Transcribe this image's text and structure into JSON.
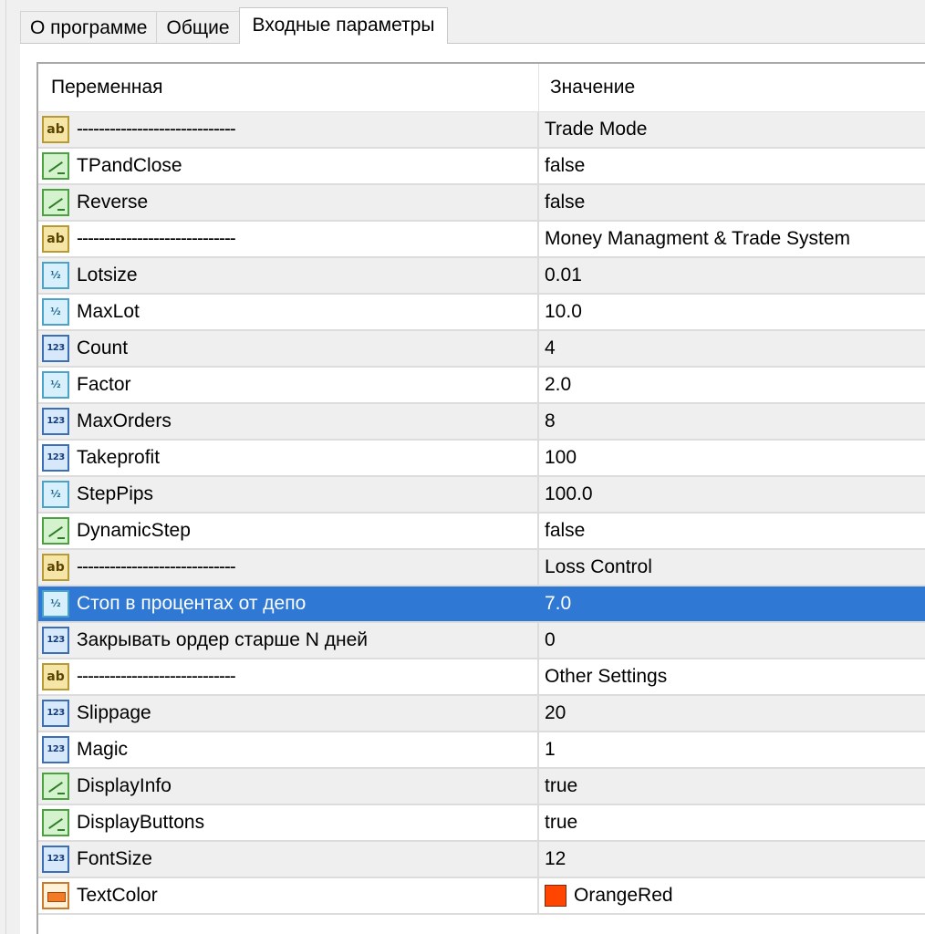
{
  "tabs": [
    {
      "label": "О программе",
      "active": false
    },
    {
      "label": "Общие",
      "active": false
    },
    {
      "label": "Входные параметры",
      "active": true
    }
  ],
  "grid": {
    "columns": {
      "variable": "Переменная",
      "value": "Значение"
    },
    "rows": [
      {
        "type": "str",
        "icon": "string-ab-icon",
        "name": "-----------------------------",
        "value": "Trade Mode"
      },
      {
        "type": "bool",
        "icon": "bool-icon",
        "name": "TPandClose",
        "value": "false"
      },
      {
        "type": "bool",
        "icon": "bool-icon",
        "name": "Reverse",
        "value": "false"
      },
      {
        "type": "str",
        "icon": "string-ab-icon",
        "name": "-----------------------------",
        "value": "Money Managment & Trade System"
      },
      {
        "type": "dbl",
        "icon": "double-icon",
        "name": "Lotsize",
        "value": "0.01"
      },
      {
        "type": "dbl",
        "icon": "double-icon",
        "name": "MaxLot",
        "value": "10.0"
      },
      {
        "type": "int",
        "icon": "integer-123-icon",
        "name": "Count",
        "value": "4"
      },
      {
        "type": "dbl",
        "icon": "double-icon",
        "name": "Factor",
        "value": "2.0"
      },
      {
        "type": "int",
        "icon": "integer-123-icon",
        "name": "MaxOrders",
        "value": "8"
      },
      {
        "type": "int",
        "icon": "integer-123-icon",
        "name": "Takeprofit",
        "value": "100"
      },
      {
        "type": "dbl",
        "icon": "double-icon",
        "name": "StepPips",
        "value": "100.0"
      },
      {
        "type": "bool",
        "icon": "bool-icon",
        "name": "DynamicStep",
        "value": "false"
      },
      {
        "type": "str",
        "icon": "string-ab-icon",
        "name": "-----------------------------",
        "value": "Loss Control"
      },
      {
        "type": "dbl",
        "icon": "double-icon",
        "name": "Стоп в процентах от депо",
        "value": "7.0",
        "selected": true
      },
      {
        "type": "int",
        "icon": "integer-123-icon",
        "name": "Закрывать ордер старше N дней",
        "value": "0"
      },
      {
        "type": "str",
        "icon": "string-ab-icon",
        "name": "-----------------------------",
        "value": "Other Settings"
      },
      {
        "type": "int",
        "icon": "integer-123-icon",
        "name": "Slippage",
        "value": "20"
      },
      {
        "type": "int",
        "icon": "integer-123-icon",
        "name": "Magic",
        "value": "1"
      },
      {
        "type": "bool",
        "icon": "bool-icon",
        "name": "DisplayInfo",
        "value": "true"
      },
      {
        "type": "bool",
        "icon": "bool-icon",
        "name": "DisplayButtons",
        "value": "true"
      },
      {
        "type": "int",
        "icon": "integer-123-icon",
        "name": "FontSize",
        "value": "12"
      },
      {
        "type": "col",
        "icon": "color-icon",
        "name": "TextColor",
        "value": "OrangeRed",
        "swatch": "#FF4500"
      }
    ]
  },
  "colors": {
    "selection": "#2F78D4",
    "stripe": "#EFEFEF"
  }
}
